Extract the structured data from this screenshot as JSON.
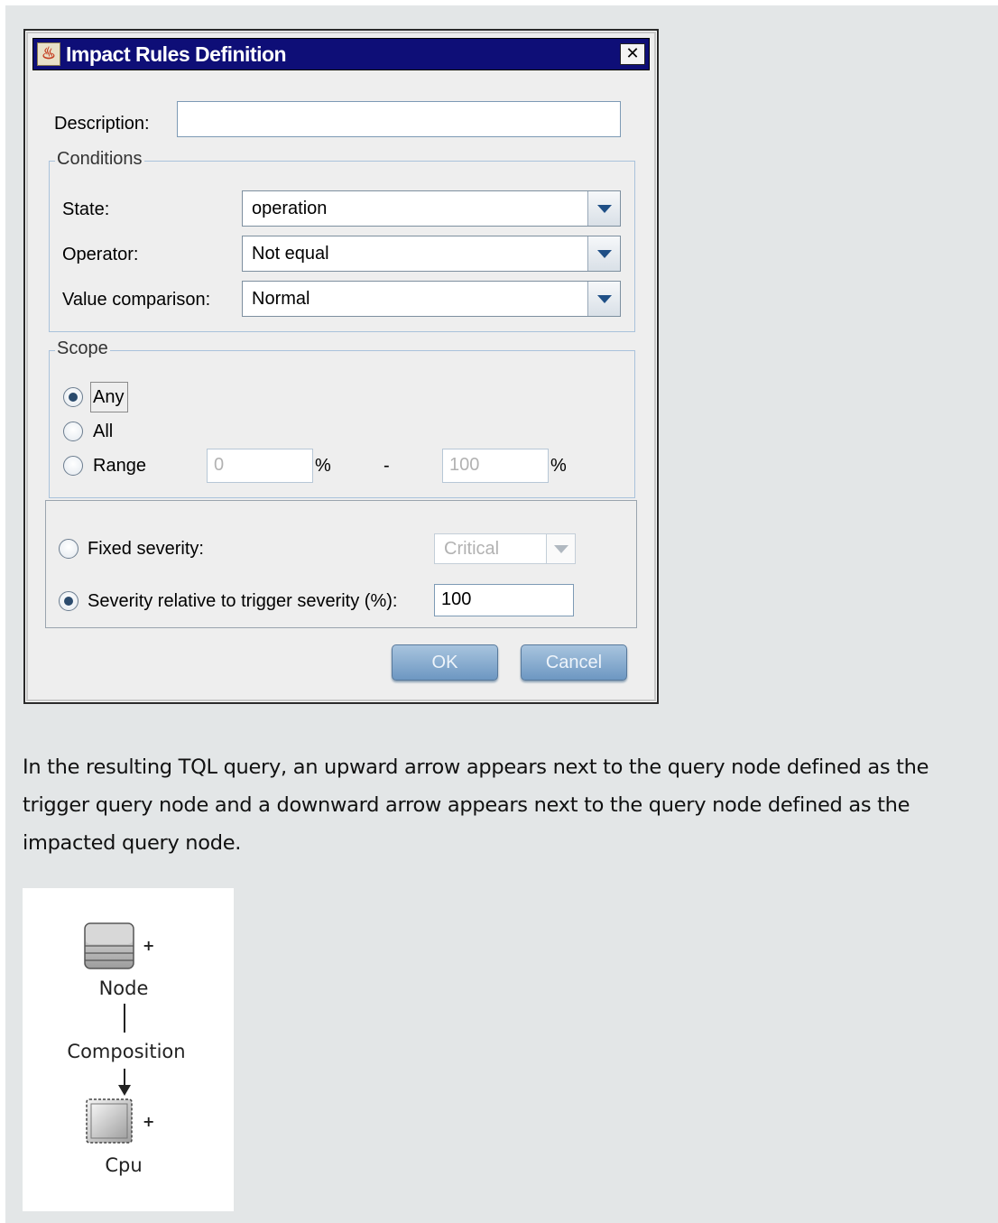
{
  "dialog": {
    "title": "Impact Rules Definition",
    "close_glyph": "✕",
    "description_label": "Description:",
    "description_value": "",
    "conditions": {
      "legend": "Conditions",
      "state_label": "State:",
      "state_value": "operation",
      "operator_label": "Operator:",
      "operator_value": "Not equal",
      "value_label": "Value comparison:",
      "value_value": "Normal"
    },
    "scope": {
      "legend": "Scope",
      "any_label": "Any",
      "all_label": "All",
      "range_label": "Range",
      "range_from": "0",
      "range_to": "100",
      "percent": "%",
      "dash": "-",
      "selected": "Any"
    },
    "severity": {
      "fixed_label": "Fixed severity:",
      "fixed_value": "Critical",
      "relative_label": "Severity relative to trigger severity (%):",
      "relative_value": "100",
      "selected": "relative"
    },
    "ok_label": "OK",
    "cancel_label": "Cancel"
  },
  "paragraph": "In the resulting TQL query, an upward arrow appears next to the query node defined as the trigger query node and a downward arrow appears next to the query node defined as the impacted query node.",
  "diagram": {
    "top_node": "Node",
    "relation": "Composition",
    "bottom_node": "Cpu",
    "top_marker": "+",
    "bottom_marker": "+"
  }
}
